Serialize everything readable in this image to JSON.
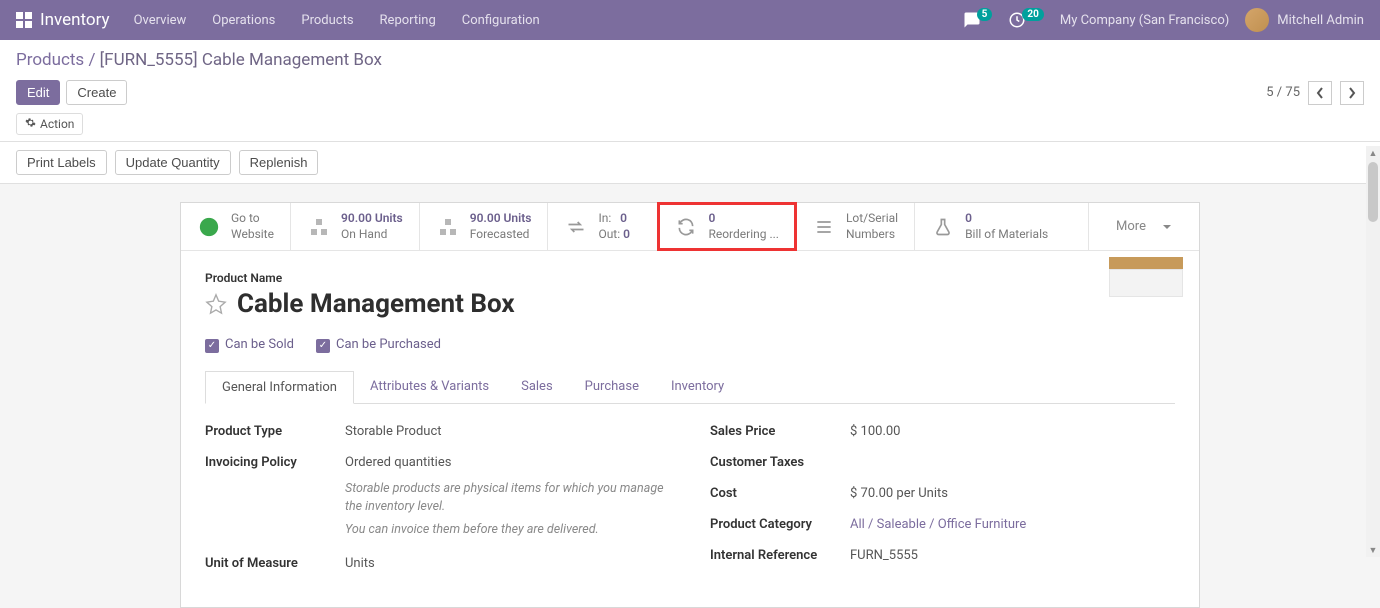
{
  "topnav": {
    "brand": "Inventory",
    "menu": [
      "Overview",
      "Operations",
      "Products",
      "Reporting",
      "Configuration"
    ],
    "chat_badge": "5",
    "activity_badge": "20",
    "company": "My Company (San Francisco)",
    "user": "Mitchell Admin"
  },
  "breadcrumb": {
    "parent": "Products",
    "current": "[FURN_5555] Cable Management Box"
  },
  "toolbar": {
    "edit": "Edit",
    "create": "Create",
    "action": "Action",
    "pager": "5 / 75"
  },
  "secondary": {
    "print_labels": "Print Labels",
    "update_qty": "Update Quantity",
    "replenish": "Replenish"
  },
  "stats": {
    "goto_website_l1": "Go to",
    "goto_website_l2": "Website",
    "onhand_val": "90.00 Units",
    "onhand_lbl": "On Hand",
    "forecast_val": "90.00 Units",
    "forecast_lbl": "Forecasted",
    "in_lbl": "In:",
    "in_val": "0",
    "out_lbl": "Out:",
    "out_val": "0",
    "reorder_val": "0",
    "reorder_lbl": "Reordering ...",
    "lot_l1": "Lot/Serial",
    "lot_l2": "Numbers",
    "bom_val": "0",
    "bom_lbl": "Bill of Materials",
    "more": "More"
  },
  "product": {
    "name_label": "Product Name",
    "name": "Cable Management Box",
    "can_sold": "Can be Sold",
    "can_purchased": "Can be Purchased"
  },
  "tabs": [
    "General Information",
    "Attributes & Variants",
    "Sales",
    "Purchase",
    "Inventory"
  ],
  "fields": {
    "product_type_l": "Product Type",
    "product_type_v": "Storable Product",
    "invoicing_l": "Invoicing Policy",
    "invoicing_v": "Ordered quantities",
    "help1": "Storable products are physical items for which you manage the inventory level.",
    "help2": "You can invoice them before they are delivered.",
    "uom_l": "Unit of Measure",
    "uom_v": "Units",
    "sales_price_l": "Sales Price",
    "sales_price_v": "$ 100.00",
    "cust_tax_l": "Customer Taxes",
    "cust_tax_v": "",
    "cost_l": "Cost",
    "cost_v": "$ 70.00 per Units",
    "category_l": "Product Category",
    "category_v": "All / Saleable / Office Furniture",
    "internal_ref_l": "Internal Reference",
    "internal_ref_v": "FURN_5555"
  }
}
